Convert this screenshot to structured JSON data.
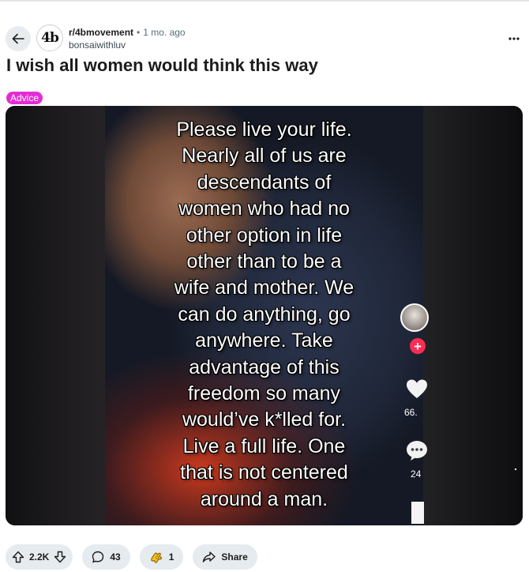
{
  "post": {
    "subreddit": "r/4bmovement",
    "separator": "•",
    "time_ago": "1 mo. ago",
    "author": "bonsaiwithluv",
    "avatar_text": "4b",
    "title": "I wish all women would think this way",
    "flair": "Advice",
    "flair_color": "#e42bd6"
  },
  "media": {
    "overlay_text": "Please live your life.\nNearly all of us are\ndescendants of\nwomen who had no\nother option in life\nother than to be a\nwife and mother. We\ncan do anything, go\nanywhere. Take\nadvantage of this\nfreedom so many\nwould’ve k*lled for.\nLive a full life. One\nthat is not centered\naround a man.",
    "side_likes": "66.",
    "side_comments": "24",
    "plus_glyph": "+"
  },
  "actions": {
    "score": "2.2K",
    "comments": "43",
    "awards": "1",
    "share_label": "Share"
  },
  "icons": {
    "back": "back-arrow-icon",
    "more": "more-options-icon",
    "upvote": "upvote-icon",
    "downvote": "downvote-icon",
    "comment": "comment-icon",
    "award": "award-icon",
    "share": "share-icon"
  },
  "colors": {
    "accent_pill": "#e5ebee",
    "tiktok_red": "#fe2c55"
  }
}
